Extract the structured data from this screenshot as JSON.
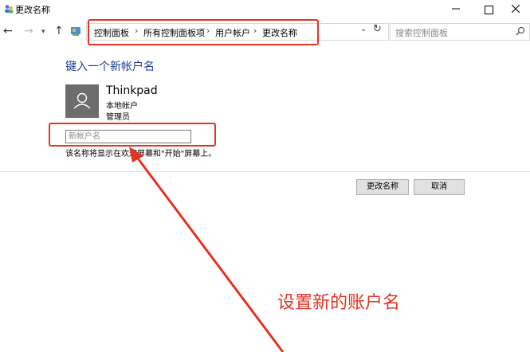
{
  "window": {
    "title": "更改名称"
  },
  "nav": {
    "breadcrumbs": [
      "控制面板",
      "所有控制面板项",
      "用户帐户",
      "更改名称"
    ],
    "search_placeholder": "搜索控制面板"
  },
  "content": {
    "heading": "键入一个新帐户名",
    "user": {
      "name": "Thinkpad",
      "type": "本地帐户",
      "role": "管理员"
    },
    "input_placeholder": "新帐户名",
    "hint": "该名称将显示在欢迎屏幕和\"开始\"屏幕上。",
    "buttons": {
      "rename": "更改名称",
      "cancel": "取消"
    }
  },
  "annotation": {
    "text": "设置新的账户名"
  },
  "colors": {
    "highlight": "#e53323",
    "heading": "#1a3f93",
    "avatar": "#6d6d6d"
  }
}
